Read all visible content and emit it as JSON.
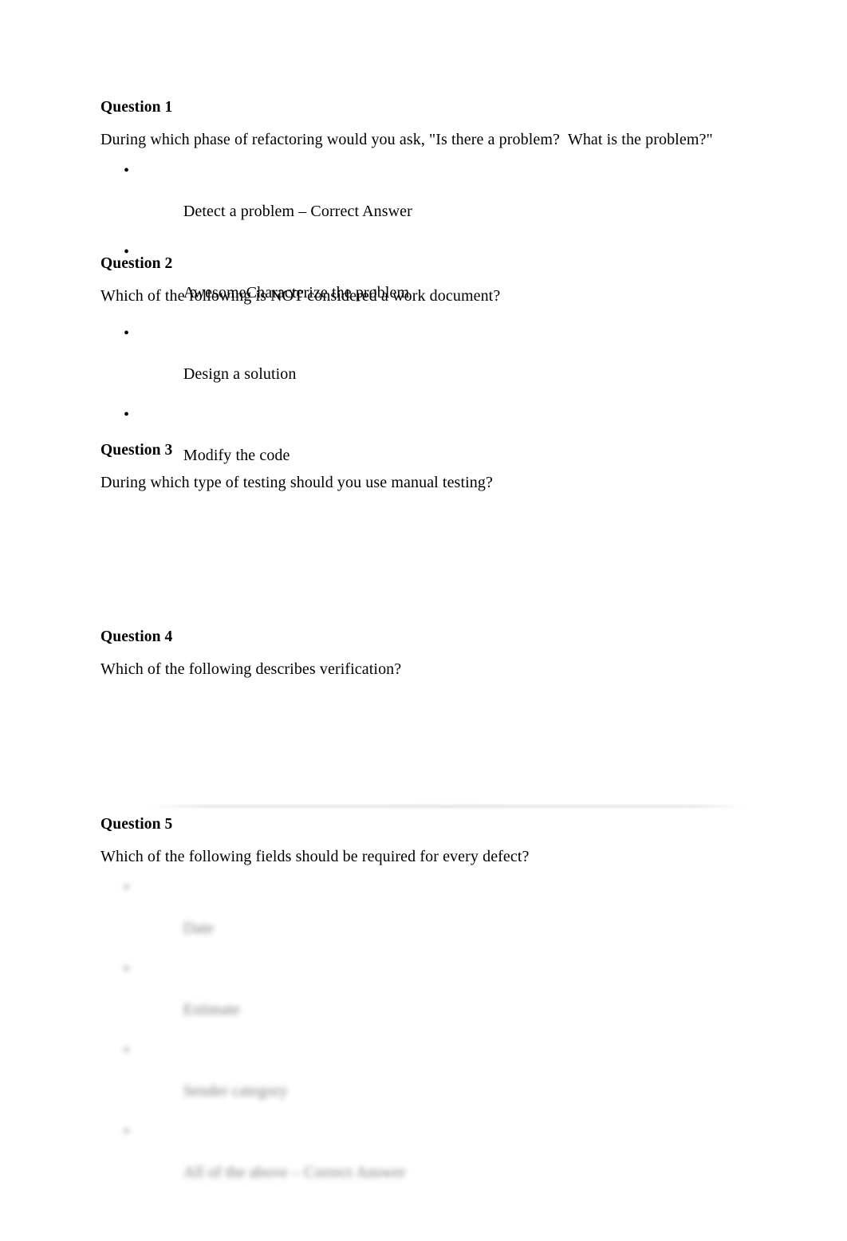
{
  "document": {
    "background_color": "#ffffff",
    "text_color": "#000000",
    "divider_color": "#787878"
  },
  "questions": [
    {
      "heading": "Question 1",
      "stem": "During which phase of refactoring would you ask, \"Is there a problem?  What is the problem?\"",
      "bullet_glyph": "•",
      "options": [
        "Detect a problem – Correct Answer",
        "AwesomeCharacterize the problem",
        "Design a solution",
        "Modify the code"
      ],
      "options_visible": true,
      "options_blurred": false
    },
    {
      "heading": "Question 2",
      "stem": "Which of the following is NOT considered a work document?",
      "bullet_glyph": "•",
      "options": [
        "",
        "",
        "",
        ""
      ],
      "options_visible": false,
      "options_blurred": false
    },
    {
      "heading": "Question 3",
      "stem": "During which type of testing should you use manual testing?",
      "bullet_glyph": "•",
      "options": [
        "",
        "",
        "",
        ""
      ],
      "options_visible": false,
      "options_blurred": false
    },
    {
      "heading": "Question 4",
      "stem": "Which of the following describes verification?",
      "bullet_glyph": "•",
      "options": [
        "",
        "",
        "",
        ""
      ],
      "options_visible": false,
      "options_blurred": false
    },
    {
      "heading": "Question 5",
      "stem": "Which of the following fields should be required for every defect?",
      "bullet_glyph": "•",
      "options": [
        "Date",
        "Estimate",
        "Sender category",
        "All of the above – Correct Answer"
      ],
      "options_visible": true,
      "options_blurred": true
    }
  ]
}
